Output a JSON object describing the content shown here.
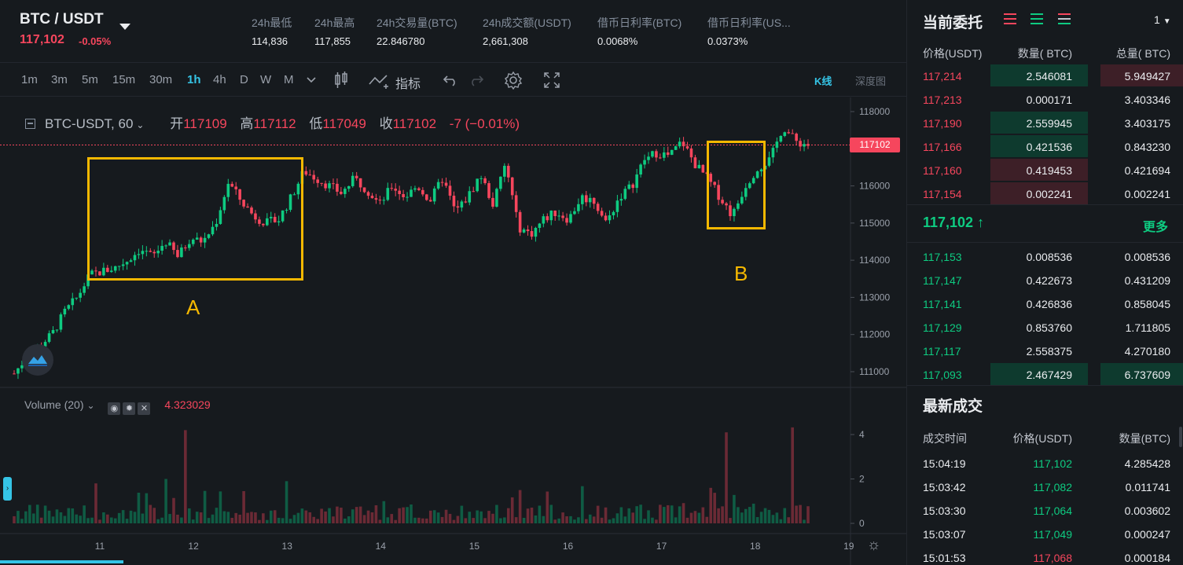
{
  "header": {
    "pair": "BTC / USDT",
    "last_price": "117,102",
    "change_pct": "-0.05%",
    "stats": [
      {
        "label": "24h最低",
        "value": "114,836"
      },
      {
        "label": "24h最高",
        "value": "117,855"
      },
      {
        "label": "24h交易量(BTC)",
        "value": "22.846780"
      },
      {
        "label": "24h成交额(USDT)",
        "value": "2,661,308"
      },
      {
        "label": "借币日利率(BTC)",
        "value": "0.0068%"
      },
      {
        "label": "借币日利率(US...",
        "value": "0.0373%"
      }
    ]
  },
  "toolbar": {
    "timeframes": [
      "1m",
      "3m",
      "5m",
      "15m",
      "30m",
      "1h",
      "4h",
      "D",
      "W",
      "M"
    ],
    "active_timeframe": "1h",
    "indicators_label": "指标",
    "kline_label": "K线",
    "depth_label": "深度图"
  },
  "legend": {
    "symbol": "BTC-USDT, 60",
    "open_label": "开",
    "open": "117109",
    "high_label": "高",
    "high": "117112",
    "low_label": "低",
    "low": "117049",
    "close_label": "收",
    "close": "117102",
    "change": "-7 (−0.01%)"
  },
  "volume_legend": {
    "label": "Volume (20)",
    "value": "4.323029"
  },
  "current_price_tag": "117102",
  "annotations": [
    {
      "label": "A"
    },
    {
      "label": "B"
    }
  ],
  "colors": {
    "up": "#0ecb81",
    "down": "#f6465d",
    "accent": "#35c4e6",
    "highlight": "#f5b800"
  },
  "chart_data": {
    "type": "candlestick",
    "interval": "1h",
    "y_axis_ticks": [
      111000,
      112000,
      113000,
      114000,
      115000,
      116000,
      117000,
      118000
    ],
    "volume_axis_ticks": [
      0,
      2,
      4
    ],
    "x_axis_ticks": [
      "11",
      "12",
      "13",
      "14",
      "15",
      "16",
      "17",
      "18",
      "19"
    ],
    "close_path": [
      110950,
      111400,
      111700,
      112000,
      112600,
      113000,
      113600,
      113700,
      113800,
      114000,
      114300,
      114100,
      114500,
      114100,
      114600,
      114500,
      115000,
      116100,
      115600,
      115200,
      115000,
      115100,
      115700,
      116400,
      116200,
      116000,
      115800,
      116200,
      115900,
      115500,
      116000,
      115700,
      116000,
      115600,
      116200,
      115300,
      115700,
      116300,
      115500,
      116600,
      114900,
      114700,
      115100,
      115300,
      115100,
      115700,
      115600,
      115000,
      115700,
      116000,
      116700,
      116900,
      116800,
      117200,
      116600,
      116200,
      115700,
      115200,
      116000,
      116500,
      116700,
      117600,
      117200,
      117102
    ]
  },
  "orderbook": {
    "title": "当前委托",
    "precision": "1",
    "headers": [
      "价格(USDT)",
      "数量( BTC)",
      "总量( BTC)"
    ],
    "asks": [
      {
        "price": "117,214",
        "qty": "2.546081",
        "total": "5.949427",
        "fill": 0.78
      },
      {
        "price": "117,213",
        "qty": "0.000171",
        "total": "3.403346",
        "fill": 0.0
      },
      {
        "price": "117,190",
        "qty": "2.559945",
        "total": "3.403175",
        "fill": 0.78
      },
      {
        "price": "117,166",
        "qty": "0.421536",
        "total": "0.843230",
        "fill": 0.78
      },
      {
        "price": "117,160",
        "qty": "0.419453",
        "total": "0.421694",
        "fill": 0.78
      },
      {
        "price": "117,154",
        "qty": "0.002241",
        "total": "0.002241",
        "fill": 0.78
      }
    ],
    "mid_price": "117,102",
    "more_label": "更多",
    "bids": [
      {
        "price": "117,153",
        "qty": "0.008536",
        "total": "0.008536"
      },
      {
        "price": "117,147",
        "qty": "0.422673",
        "total": "0.431209"
      },
      {
        "price": "117,141",
        "qty": "0.426836",
        "total": "0.858045"
      },
      {
        "price": "117,129",
        "qty": "0.853760",
        "total": "1.711805"
      },
      {
        "price": "117,117",
        "qty": "2.558375",
        "total": "4.270180"
      },
      {
        "price": "117,093",
        "qty": "2.467429",
        "total": "6.737609"
      }
    ]
  },
  "trades": {
    "title": "最新成交",
    "headers": [
      "成交时间",
      "价格(USDT)",
      "数量(BTC)"
    ],
    "rows": [
      {
        "time": "15:04:19",
        "price": "117,102",
        "qty": "4.285428",
        "side": "buy"
      },
      {
        "time": "15:03:42",
        "price": "117,082",
        "qty": "0.011741",
        "side": "buy"
      },
      {
        "time": "15:03:30",
        "price": "117,064",
        "qty": "0.003602",
        "side": "buy"
      },
      {
        "time": "15:03:07",
        "price": "117,049",
        "qty": "0.000247",
        "side": "buy"
      },
      {
        "time": "15:01:53",
        "price": "117,068",
        "qty": "0.000184",
        "side": "sell"
      }
    ]
  }
}
